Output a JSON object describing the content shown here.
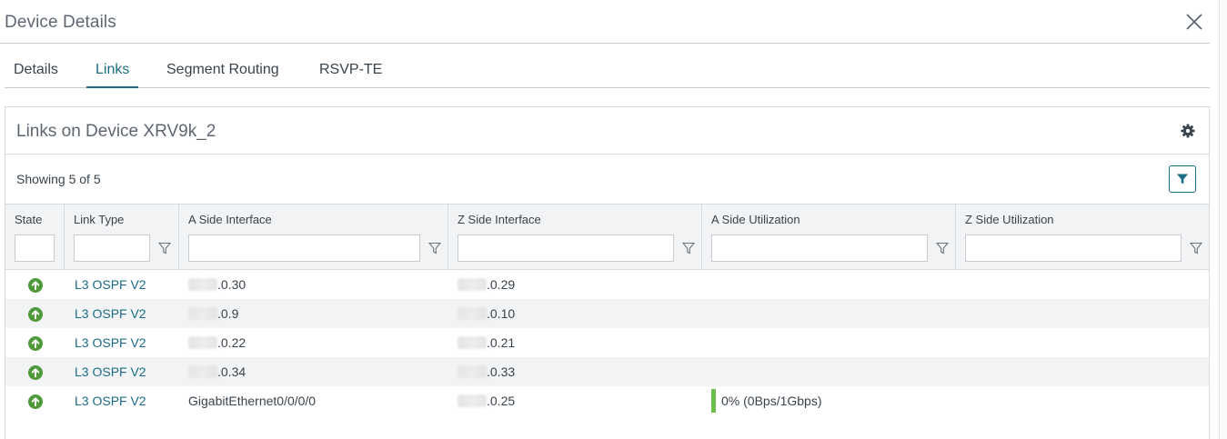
{
  "dialog": {
    "title": "Device Details"
  },
  "tabs": [
    {
      "label": "Details",
      "active": false
    },
    {
      "label": "Links",
      "active": true
    },
    {
      "label": "Segment Routing",
      "active": false
    },
    {
      "label": "RSVP-TE",
      "active": false
    }
  ],
  "card": {
    "title": "Links on Device XRV9k_2",
    "showing": "Showing 5 of 5"
  },
  "columns": {
    "state": "State",
    "link_type": "Link Type",
    "a_side_interface": "A Side Interface",
    "z_side_interface": "Z Side Interface",
    "a_side_utilization": "A Side Utilization",
    "z_side_utilization": "Z Side Utilization"
  },
  "rows": [
    {
      "state": "up",
      "link_type": "L3 OSPF V2",
      "a_side": ".0.30",
      "a_side_redacted": true,
      "z_side": ".0.29",
      "z_side_redacted": true,
      "a_util": "",
      "z_util": ""
    },
    {
      "state": "up",
      "link_type": "L3 OSPF V2",
      "a_side": ".0.9",
      "a_side_redacted": true,
      "z_side": ".0.10",
      "z_side_redacted": true,
      "a_util": "",
      "z_util": ""
    },
    {
      "state": "up",
      "link_type": "L3 OSPF V2",
      "a_side": ".0.22",
      "a_side_redacted": true,
      "z_side": ".0.21",
      "z_side_redacted": true,
      "a_util": "",
      "z_util": ""
    },
    {
      "state": "up",
      "link_type": "L3 OSPF V2",
      "a_side": ".0.34",
      "a_side_redacted": true,
      "z_side": ".0.33",
      "z_side_redacted": true,
      "a_util": "",
      "z_util": ""
    },
    {
      "state": "up",
      "link_type": "L3 OSPF V2",
      "a_side": "GigabitEthernet0/0/0/0",
      "a_side_redacted": false,
      "z_side": ".0.25",
      "z_side_redacted": true,
      "a_util": "0% (0Bps/1Gbps)",
      "a_util_percent": 0,
      "z_util": ""
    }
  ],
  "colors": {
    "accent": "#1b6c85",
    "state_up": "#4e9a3a",
    "util_bar": "#6cc04a",
    "row_alt": "#f2f3f4"
  },
  "icons": {
    "close": "close-icon",
    "settings": "gear-icon",
    "filter": "filter-icon",
    "state_up": "arrow-up-circle-icon"
  }
}
